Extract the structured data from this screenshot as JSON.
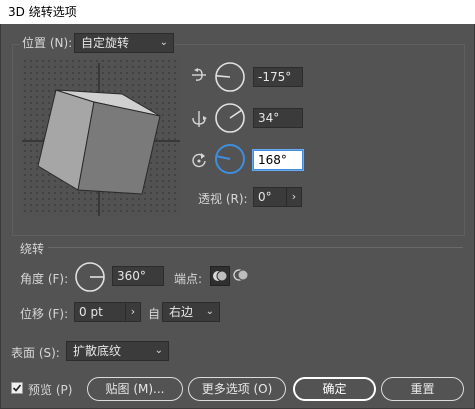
{
  "window": {
    "title": "3D 绕转选项"
  },
  "position": {
    "label": "位置 (N):",
    "preset_value": "自定旋转",
    "rot_x": "-175°",
    "rot_y": "34°",
    "rot_z": "168°",
    "perspective_label": "透视 (R):",
    "perspective_value": "0°"
  },
  "revolve": {
    "section_label": "绕转",
    "angle_label": "角度 (F):",
    "angle_value": "360°",
    "cap_label": "端点:",
    "offset_label": "位移 (F):",
    "offset_value": "0 pt",
    "from_label": "自",
    "from_value": "右边"
  },
  "surface": {
    "label": "表面 (S):",
    "value": "扩散底纹"
  },
  "footer": {
    "preview_label": "预览 (P)",
    "preview_checked": true,
    "map_art_label": "贴图 (M)...",
    "more_options_label": "更多选项 (O)",
    "ok_label": "确定",
    "reset_label": "重置"
  },
  "colors": {
    "background": "#535353",
    "field": "#3b3b3b",
    "active_accent": "#3e8ede"
  },
  "icons": {
    "rot_x": "rotate-x-axis-icon",
    "rot_y": "rotate-y-axis-icon",
    "rot_z": "rotate-z-axis-icon",
    "cap_on": "cap-on-icon",
    "cap_off": "cap-off-icon"
  }
}
